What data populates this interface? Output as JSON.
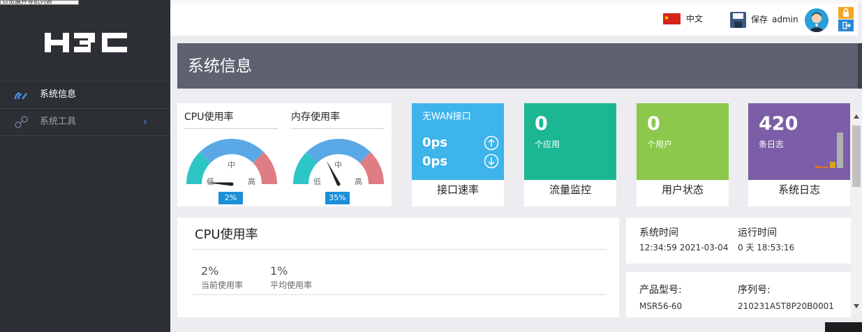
{
  "tooltip": "点击展开导航列表",
  "sidebar": {
    "items": [
      {
        "label": "系统信息"
      },
      {
        "label": "系统工具"
      }
    ]
  },
  "header": {
    "language": "中文",
    "save_label": "保存",
    "username": "admin"
  },
  "page": {
    "title": "系统信息"
  },
  "gauges": [
    {
      "title": "CPU使用率",
      "value": "2%",
      "low": "低",
      "mid": "中",
      "high": "高",
      "needle_percent": 2
    },
    {
      "title": "内存使用率",
      "value": "35%",
      "low": "低",
      "mid": "中",
      "high": "高",
      "needle_percent": 35
    }
  ],
  "tiles": {
    "interface": {
      "header": "无WAN接口",
      "up": "0ps",
      "down": "0ps",
      "label": "接口速率",
      "color": "#3db4ea"
    },
    "traffic": {
      "value": "0",
      "unit": "个应用",
      "label": "流量监控",
      "color": "#1bb792"
    },
    "users": {
      "value": "0",
      "unit": "个用户",
      "label": "用户状态",
      "color": "#8cc84b"
    },
    "logs": {
      "value": "420",
      "unit": "条日志",
      "label": "系统日志",
      "color": "#7b5ea7"
    }
  },
  "cpu_panel": {
    "title": "CPU使用率",
    "current_value": "2%",
    "current_label": "当前使用率",
    "average_value": "1%",
    "average_label": "平均使用率"
  },
  "system_time": {
    "label": "系统时间",
    "value": "12:34:59  2021-03-04",
    "uptime_label": "运行时间",
    "uptime_value": "0 天   18:53:16"
  },
  "product": {
    "model_label": "产品型号:",
    "model_value": "MSR56-60",
    "serial_label": "序列号:",
    "serial_value": "210231A5T8P20B0001"
  },
  "colors": {
    "sidebar_bg": "#2c2f34",
    "titlebar_bg": "#5d6170",
    "gauge_low": "#2ec5c7",
    "gauge_mid": "#5aa9e6",
    "gauge_high": "#e07c84",
    "value_badge": "#1b8fd8"
  }
}
